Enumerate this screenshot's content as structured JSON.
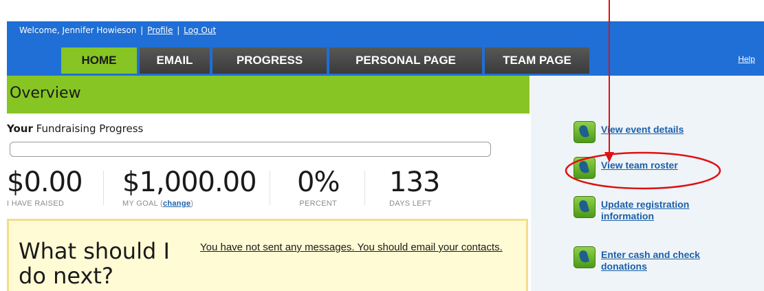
{
  "header": {
    "welcome_text": "Welcome, Jennifer Howieson",
    "profile_link": "Profile",
    "logout_link": "Log Out",
    "help_link": "Help",
    "tabs": [
      {
        "label": "HOME",
        "active": true
      },
      {
        "label": "EMAIL",
        "active": false
      },
      {
        "label": "PROGRESS",
        "active": false
      },
      {
        "label": "PERSONAL PAGE",
        "active": false
      },
      {
        "label": "TEAM PAGE",
        "active": false
      }
    ]
  },
  "overview": {
    "title": "Overview"
  },
  "progress": {
    "heading_bold": "Your",
    "heading_rest": "Fundraising Progress",
    "percent_complete": 0,
    "stats": [
      {
        "value": "$0.00",
        "label": "I HAVE RAISED"
      },
      {
        "value": "$1,000.00",
        "label": "MY GOAL",
        "link": "change"
      },
      {
        "value": "0%",
        "label": "PERCENT"
      },
      {
        "value": "133",
        "label": "DAYS LEFT"
      }
    ]
  },
  "next": {
    "heading": "What should I do next?",
    "message": "You have not sent any messages. You should email your contacts."
  },
  "sidebar": {
    "links": [
      {
        "label": "View event details",
        "icon": "runner-icon"
      },
      {
        "label": "View team roster",
        "icon": "runner-icon",
        "highlighted": true
      },
      {
        "label": "Update registration information",
        "icon": "runner-icon"
      },
      {
        "label": "Enter cash and check donations",
        "icon": "runner-icon"
      }
    ]
  },
  "colors": {
    "header_blue": "#1f6fd6",
    "accent_green": "#86c524",
    "tab_gray": "#4a4a4a",
    "link_blue": "#1b5fa8",
    "annotation_red": "#e01010",
    "next_box_bg": "#fffbd5"
  }
}
